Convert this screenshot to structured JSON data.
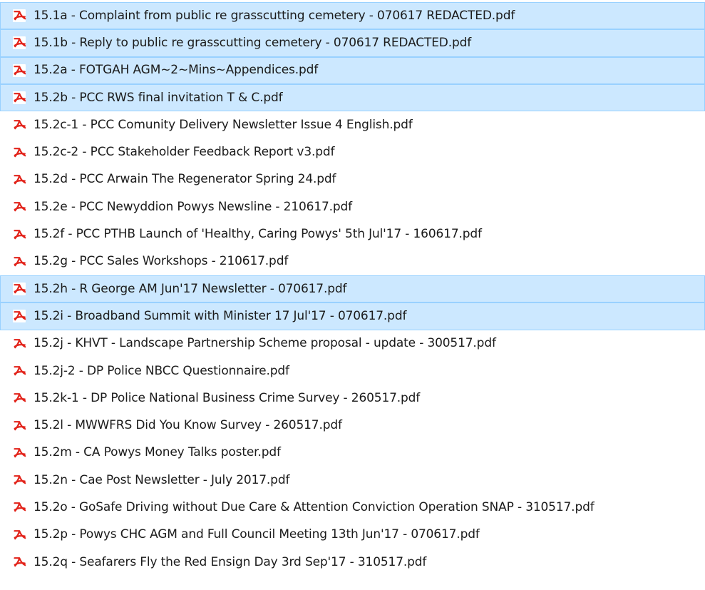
{
  "colors": {
    "selection_bg": "#cce8ff",
    "selection_border": "#99d1ff",
    "pdf_icon_red": "#e2231a",
    "text": "#1b1b1b"
  },
  "file_icon": "pdf-file-icon",
  "files": [
    {
      "name": "15.1a - Complaint from public re grasscutting cemetery - 070617 REDACTED.pdf",
      "selected": true
    },
    {
      "name": "15.1b - Reply to public re grasscutting cemetery - 070617 REDACTED.pdf",
      "selected": true
    },
    {
      "name": "15.2a - FOTGAH AGM~2~Mins~Appendices.pdf",
      "selected": true
    },
    {
      "name": "15.2b - PCC RWS final invitation T & C.pdf",
      "selected": true
    },
    {
      "name": "15.2c-1 - PCC Comunity Delivery Newsletter Issue 4 English.pdf",
      "selected": false
    },
    {
      "name": "15.2c-2 - PCC Stakeholder Feedback Report  v3.pdf",
      "selected": false
    },
    {
      "name": "15.2d - PCC Arwain The Regenerator Spring 24.pdf",
      "selected": false
    },
    {
      "name": "15.2e - PCC Newyddion Powys Newsline - 210617.pdf",
      "selected": false
    },
    {
      "name": "15.2f - PCC PTHB Launch of 'Healthy, Caring Powys' 5th Jul'17 - 160617.pdf",
      "selected": false
    },
    {
      "name": "15.2g - PCC Sales Workshops - 210617.pdf",
      "selected": false
    },
    {
      "name": "15.2h - R George AM Jun'17 Newsletter - 070617.pdf",
      "selected": true
    },
    {
      "name": "15.2i - Broadband Summit with Minister 17 Jul'17 - 070617.pdf",
      "selected": true
    },
    {
      "name": "15.2j - KHVT - Landscape Partnership Scheme proposal - update - 300517.pdf",
      "selected": false
    },
    {
      "name": "15.2j-2 - DP Police NBCC Questionnaire.pdf",
      "selected": false
    },
    {
      "name": "15.2k-1 - DP Police National Business Crime Survey - 260517.pdf",
      "selected": false
    },
    {
      "name": "15.2l - MWWFRS Did You Know Survey - 260517.pdf",
      "selected": false
    },
    {
      "name": "15.2m - CA Powys Money Talks poster.pdf",
      "selected": false
    },
    {
      "name": "15.2n - Cae Post Newsletter - July 2017.pdf",
      "selected": false
    },
    {
      "name": "15.2o - GoSafe Driving without Due Care & Attention Conviction Operation SNAP - 310517.pdf",
      "selected": false
    },
    {
      "name": "15.2p - Powys CHC AGM and Full Council Meeting 13th Jun'17 - 070617.pdf",
      "selected": false
    },
    {
      "name": "15.2q - Seafarers Fly the Red Ensign Day 3rd Sep'17 - 310517.pdf",
      "selected": false
    }
  ]
}
